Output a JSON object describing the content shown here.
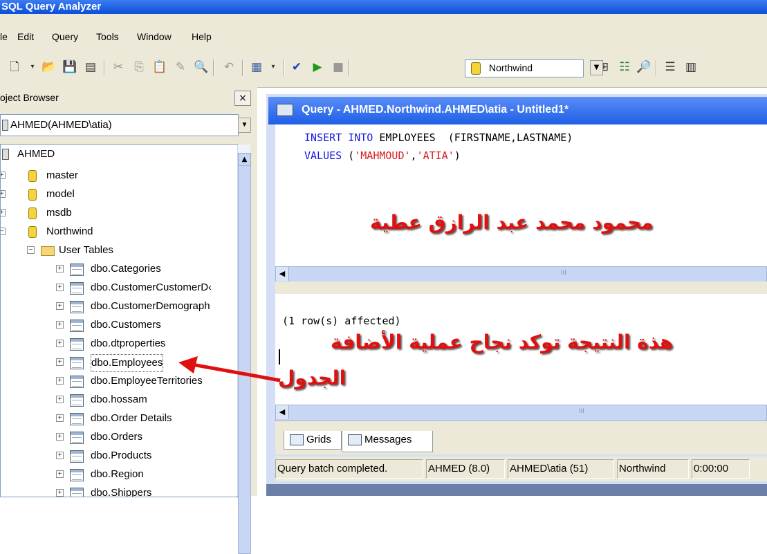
{
  "app": {
    "title": "SQL Query Analyzer"
  },
  "menu": [
    "le",
    "Edit",
    "Query",
    "Tools",
    "Window",
    "Help"
  ],
  "toolbar": {
    "database": "Northwind"
  },
  "object_browser": {
    "title": "oject Browser",
    "close": "×",
    "server_combo": "AHMED(AHMED\\atia)",
    "tree": {
      "root": "AHMED",
      "databases": [
        "master",
        "model",
        "msdb",
        "Northwind"
      ],
      "folder": "User Tables",
      "tables": [
        "dbo.Categories",
        "dbo.CustomerCustomerD‹",
        "dbo.CustomerDemograph",
        "dbo.Customers",
        "dbo.dtproperties",
        "dbo.Employees",
        "dbo.EmployeeTerritories",
        "dbo.hossam",
        "dbo.Order Details",
        "dbo.Orders",
        "dbo.Products",
        "dbo.Region",
        "dbo.Shippers"
      ]
    }
  },
  "query_window": {
    "title": "Query - AHMED.Northwind.AHMED\\atia - Untitled1*",
    "code": {
      "line1": {
        "kw": "INSERT INTO",
        "rest": " EMPLOYEES  (FIRSTNAME,LASTNAME)"
      },
      "line2": {
        "kw": "VALUES",
        "open": " (",
        "s1": "'MAHMOUD'",
        "comma": ",",
        "s2": "'ATIA'",
        "close": ")"
      }
    },
    "scroll_mark": "III",
    "result_text": "(1 row(s) affected)",
    "tabs": [
      "Grids",
      "Messages"
    ],
    "status": [
      "Query batch completed.",
      "AHMED (8.0)",
      "AHMED\\atia (51)",
      "Northwind",
      "0:00:00"
    ]
  },
  "annotations": {
    "name": "محمود محمد عبد الرازق عطية",
    "success": "هذة النتيجة توكد نجاح عملية الأضافة",
    "table": "الجدول"
  },
  "colors": {
    "title_bar": "#1e5fe6",
    "annotation": "#e01010",
    "keyword": "#1a1adf",
    "string": "#d81c1c"
  }
}
